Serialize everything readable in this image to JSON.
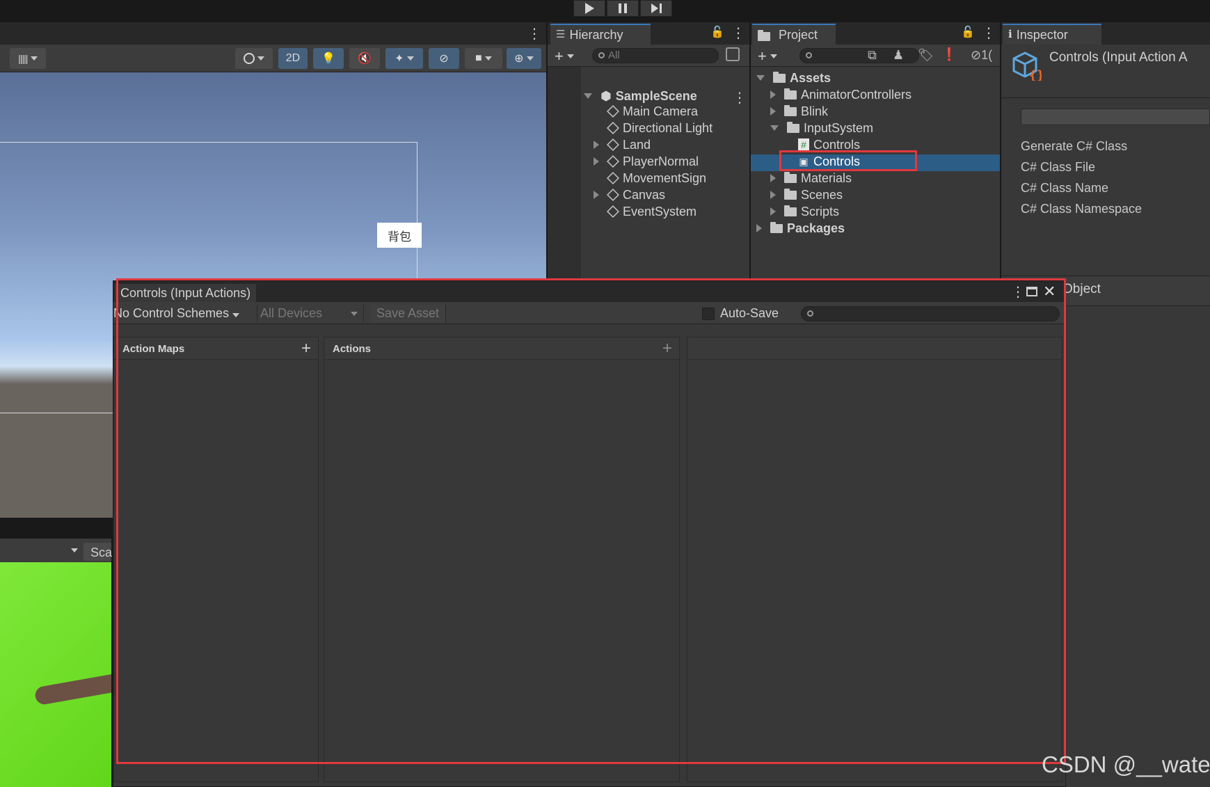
{
  "toolbar": {
    "play": "play-icon",
    "pause": "pause-icon",
    "step": "step-icon"
  },
  "scene": {
    "toolbar_2d": "2D",
    "bag_button": "背包",
    "game_scale_label": "Sca"
  },
  "hierarchy": {
    "tab": "Hierarchy",
    "search_placeholder": "All",
    "scene_name": "SampleScene",
    "items": [
      {
        "label": "Main Camera",
        "expandable": false
      },
      {
        "label": "Directional Light",
        "expandable": false
      },
      {
        "label": "Land",
        "expandable": true
      },
      {
        "label": "PlayerNormal",
        "expandable": true
      },
      {
        "label": "MovementSign",
        "expandable": false
      },
      {
        "label": "Canvas",
        "expandable": true
      },
      {
        "label": "EventSystem",
        "expandable": false
      }
    ]
  },
  "project": {
    "tab": "Project",
    "root": "Assets",
    "folders": [
      {
        "label": "AnimatorControllers"
      },
      {
        "label": "Blink"
      },
      {
        "label": "InputSystem",
        "open": true
      },
      {
        "label": "Materials"
      },
      {
        "label": "Scenes"
      },
      {
        "label": "Scripts"
      }
    ],
    "input_children": [
      {
        "label": "Controls",
        "type": "script"
      },
      {
        "label": "Controls",
        "type": "input-actions",
        "selected": true
      }
    ],
    "packages": "Packages",
    "hidden_count": "1("
  },
  "inspector": {
    "tab": "Inspector",
    "title": "Controls (Input Action A",
    "fields": [
      "Generate C# Class",
      "C# Class File",
      "C# Class Name",
      "C# Class Namespace"
    ],
    "object_label": "Object"
  },
  "input_actions": {
    "window_title": "Controls (Input Actions)",
    "control_schemes": "No Control Schemes",
    "devices": "All Devices",
    "save_asset": "Save Asset",
    "auto_save": "Auto-Save",
    "action_maps": "Action Maps",
    "actions": "Actions"
  },
  "colors": {
    "accent": "#3a79bb",
    "selection": "#2c5d87",
    "highlight": "#e0393e"
  },
  "watermark": "CSDN @__water"
}
